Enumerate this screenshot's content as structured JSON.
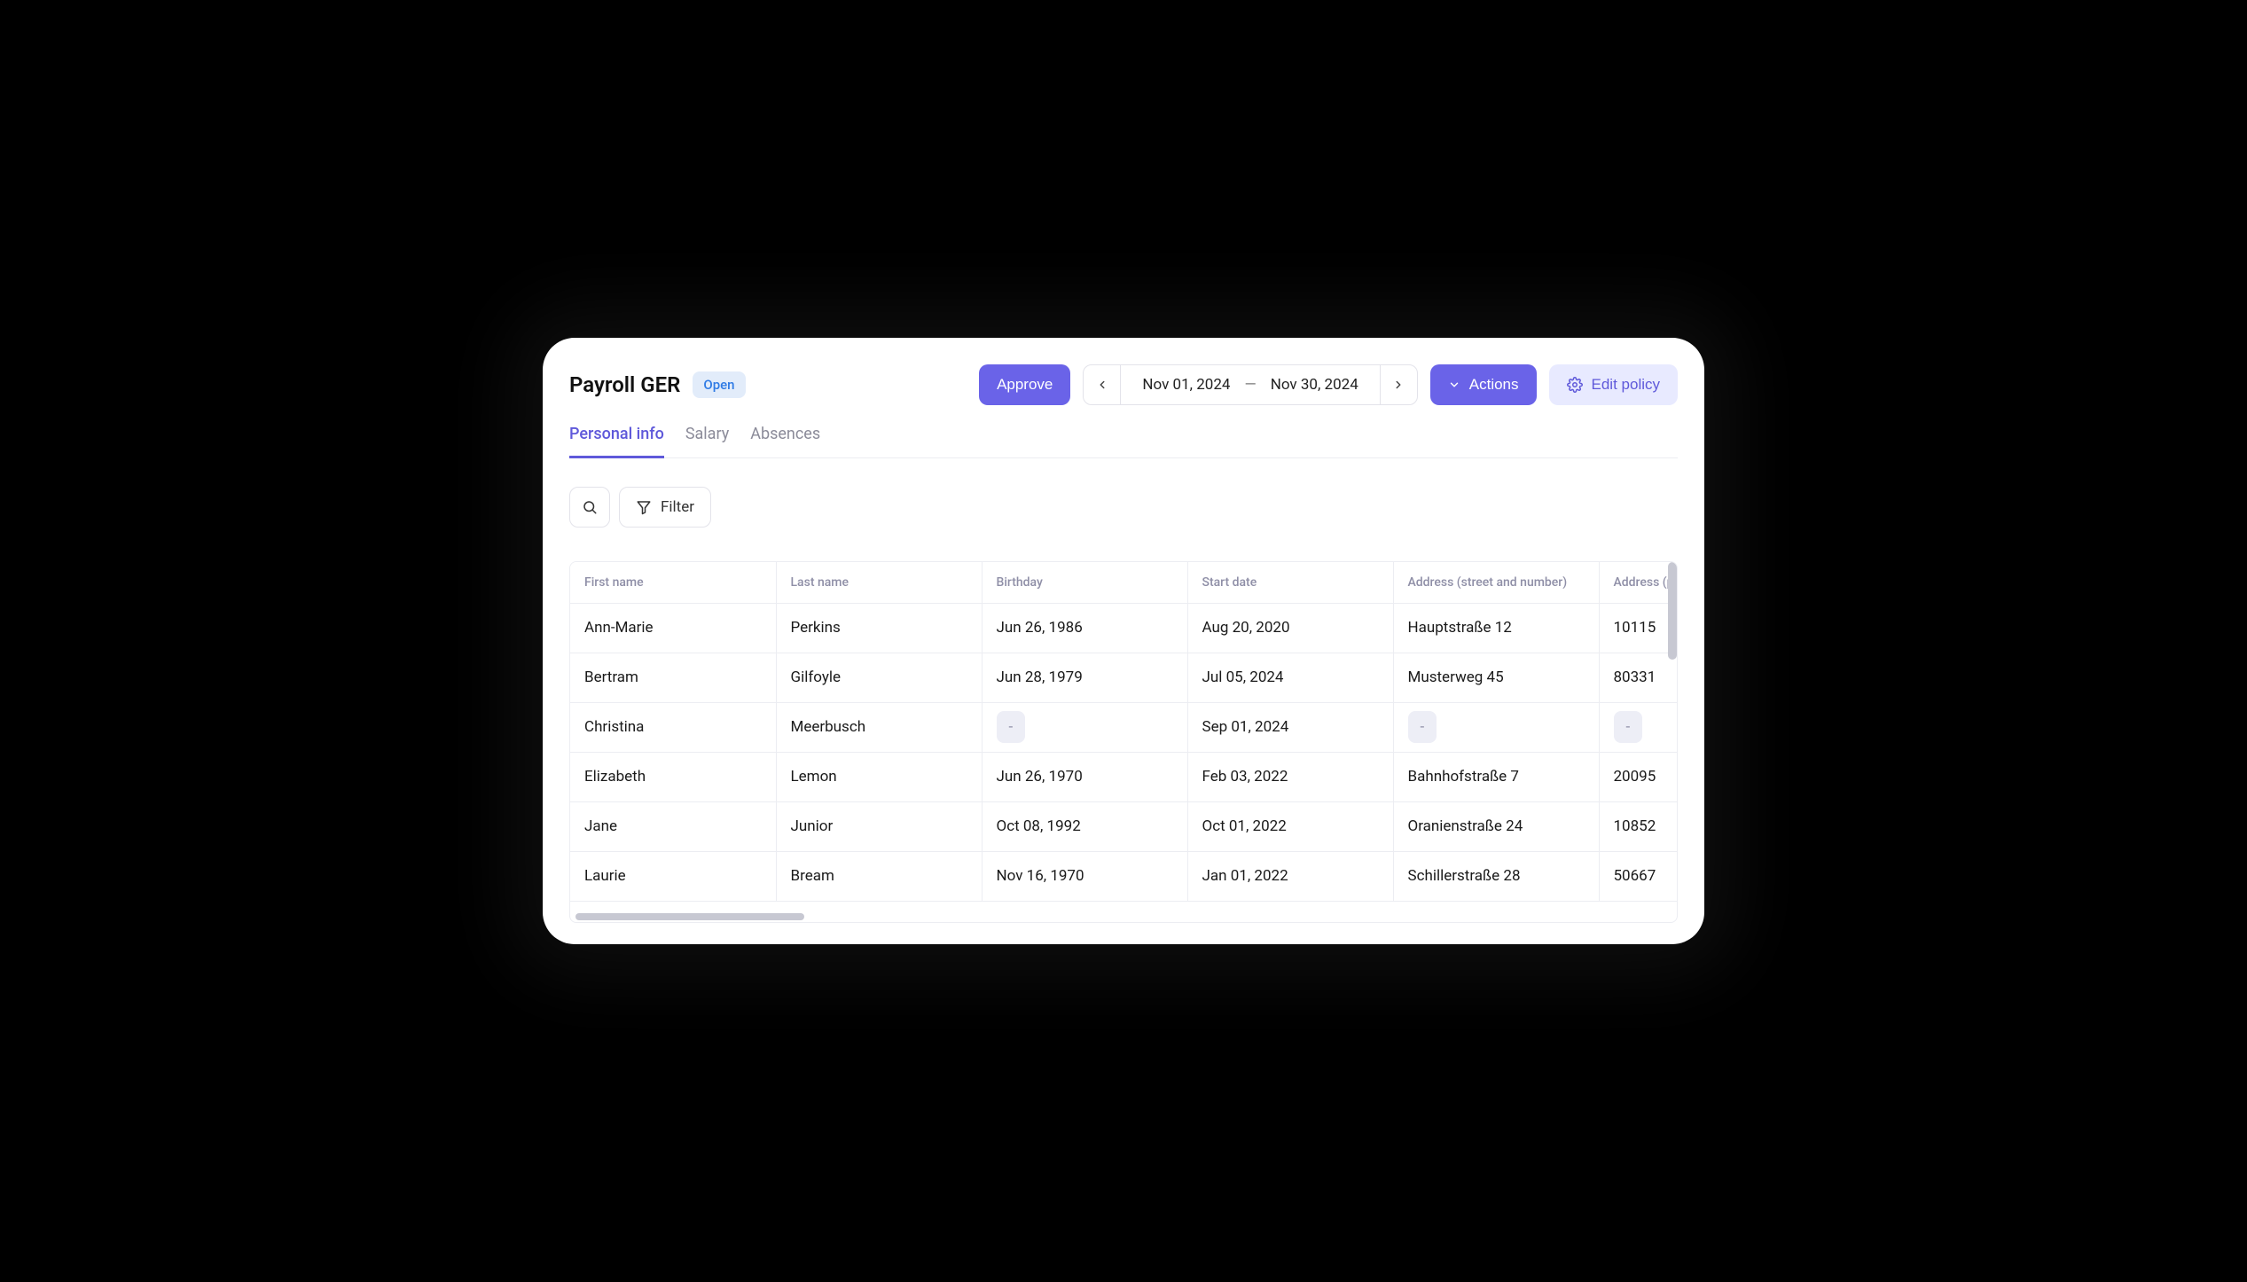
{
  "header": {
    "title": "Payroll GER",
    "status_badge": "Open",
    "approve_label": "Approve",
    "date_from": "Nov 01, 2024",
    "date_sep": "—",
    "date_to": "Nov 30, 2024",
    "actions_label": "Actions",
    "edit_policy_label": "Edit policy"
  },
  "tabs": [
    {
      "label": "Personal info",
      "active": true
    },
    {
      "label": "Salary",
      "active": false
    },
    {
      "label": "Absences",
      "active": false
    }
  ],
  "toolbar": {
    "filter_label": "Filter"
  },
  "table": {
    "columns": [
      "First name",
      "Last name",
      "Birthday",
      "Start date",
      "Address (street and number)",
      "Address (postal code)"
    ],
    "rows": [
      {
        "first": "Ann-Marie",
        "last": "Perkins",
        "birthday": "Jun 26, 1986",
        "start": "Aug 20, 2020",
        "address": "Hauptstraße 12",
        "postal": "10115"
      },
      {
        "first": "Bertram",
        "last": "Gilfoyle",
        "birthday": "Jun 28, 1979",
        "start": "Jul 05, 2024",
        "address": "Musterweg 45",
        "postal": "80331"
      },
      {
        "first": "Christina",
        "last": "Meerbusch",
        "birthday": "-",
        "start": "Sep 01, 2024",
        "address": "-",
        "postal": "-"
      },
      {
        "first": "Elizabeth",
        "last": "Lemon",
        "birthday": "Jun 26, 1970",
        "start": "Feb 03, 2022",
        "address": "Bahnhofstraße 7",
        "postal": "20095"
      },
      {
        "first": "Jane",
        "last": "Junior",
        "birthday": "Oct 08, 1992",
        "start": "Oct 01, 2022",
        "address": "Oranienstraße 24",
        "postal": "10852"
      },
      {
        "first": "Laurie",
        "last": "Bream",
        "birthday": "Nov 16, 1970",
        "start": "Jan 01, 2022",
        "address": "Schillerstraße 28",
        "postal": "50667"
      }
    ]
  }
}
